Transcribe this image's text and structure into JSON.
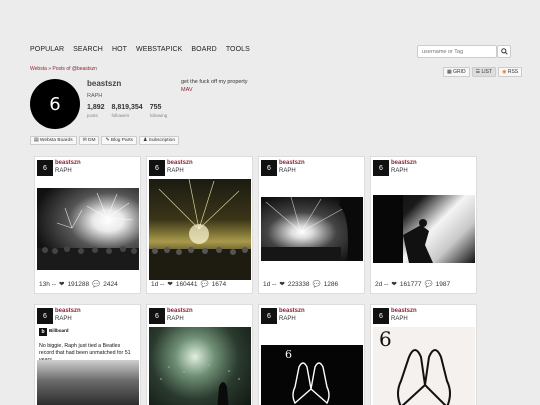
{
  "nav": [
    "POPULAR",
    "SEARCH",
    "HOT",
    "WEBSTAPICK",
    "BOARD",
    "TOOLS"
  ],
  "search": {
    "placeholder": "username or Tag"
  },
  "breadcrumb": "Websta » Posts of @beastszn",
  "profile": {
    "avatar_text": "6",
    "username": "beastszn",
    "full_name": "RAPH",
    "posts": "1,892",
    "posts_label": "posts",
    "followers": "8,819,354",
    "followers_label": "followers",
    "following": "755",
    "following_label": "following",
    "bio": "get the fuck off my property",
    "bio_link": "MAV"
  },
  "view": {
    "grid": "GRID",
    "list": "LIST",
    "rss": "RSS"
  },
  "actions": [
    "Websta Boards",
    "DM",
    "Blog Parts",
    "Subscription"
  ],
  "posts": [
    {
      "user": "beastszn",
      "name": "RAPH",
      "time": "13h --",
      "likes": "191288",
      "comments": "2424"
    },
    {
      "user": "beastszn",
      "name": "RAPH",
      "time": "1d --",
      "likes": "160441",
      "comments": "1674"
    },
    {
      "user": "beastszn",
      "name": "RAPH",
      "time": "1d --",
      "likes": "223338",
      "comments": "1286"
    },
    {
      "user": "beastszn",
      "name": "RAPH",
      "time": "2d --",
      "likes": "161777",
      "comments": "1987"
    },
    {
      "user": "beastszn",
      "name": "RAPH",
      "caption_brand": "Billboard",
      "caption": "No biggie, Raph just tied a Beatles record that had been unmatched for 51 years"
    },
    {
      "user": "beastszn",
      "name": "RAPH"
    },
    {
      "user": "beastszn",
      "name": "RAPH",
      "overlay": "6"
    },
    {
      "user": "beastszn",
      "name": "RAPH",
      "overlay": "6"
    }
  ]
}
